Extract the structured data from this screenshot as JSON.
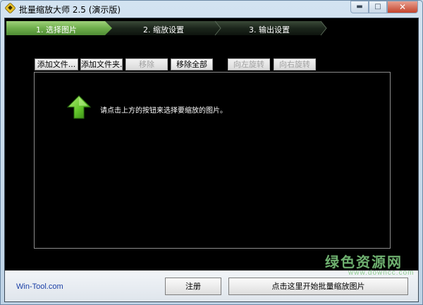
{
  "window": {
    "title": "批量缩放大师 2.5 (演示版)",
    "minimize_icon": "minimize-icon",
    "maximize_icon": "maximize-icon",
    "close_icon": "close-icon"
  },
  "steps": [
    {
      "label": "1. 选择图片",
      "active": true
    },
    {
      "label": "2. 缩放设置",
      "active": false
    },
    {
      "label": "3. 输出设置",
      "active": false
    }
  ],
  "toolbar": {
    "add_file": "添加文件...",
    "add_folder": "添加文件夹...",
    "remove": "移除",
    "remove_all": "移除全部",
    "rotate_left": "向左旋转",
    "rotate_right": "向右旋转"
  },
  "list": {
    "hint": "请点击上方的按钮来选择要缩放的图片。",
    "hint_icon": "up-arrow-icon"
  },
  "footer": {
    "site": "Win-Tool.com",
    "register": "注册",
    "start": "点击这里开始批量缩放图片"
  },
  "watermark": {
    "text": "绿色资源网",
    "url": "www.downcc.com"
  },
  "colors": {
    "step_active": "#7ab85a",
    "step_inactive": "#1e2a1e",
    "arrow_green": "#6fd23a",
    "client_bg": "#000000"
  }
}
